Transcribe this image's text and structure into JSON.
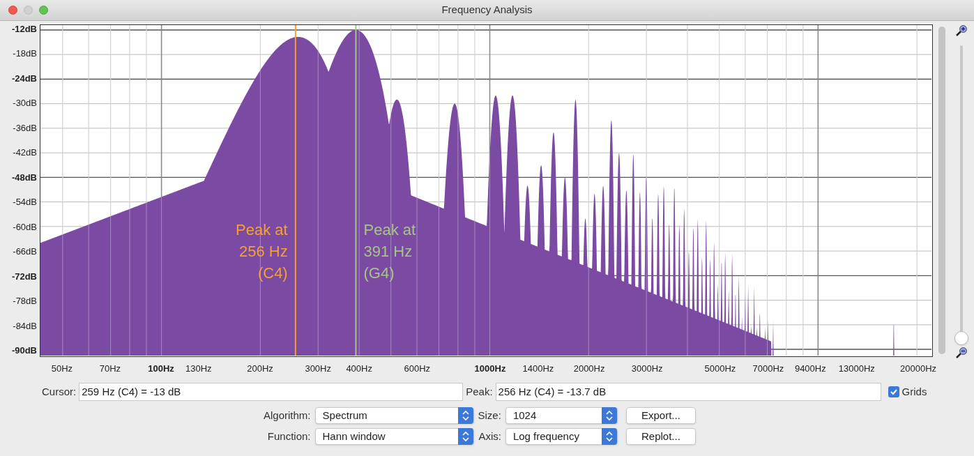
{
  "window": {
    "title": "Frequency Analysis"
  },
  "plot": {
    "y_ticks": [
      {
        "label": "-12dB",
        "major": true
      },
      {
        "label": "-18dB",
        "major": false
      },
      {
        "label": "-24dB",
        "major": true
      },
      {
        "label": "-30dB",
        "major": false
      },
      {
        "label": "-36dB",
        "major": false
      },
      {
        "label": "-42dB",
        "major": false
      },
      {
        "label": "-48dB",
        "major": true
      },
      {
        "label": "-54dB",
        "major": false
      },
      {
        "label": "-60dB",
        "major": false
      },
      {
        "label": "-66dB",
        "major": false
      },
      {
        "label": "-72dB",
        "major": true
      },
      {
        "label": "-78dB",
        "major": false
      },
      {
        "label": "-84dB",
        "major": false
      },
      {
        "label": "-90dB",
        "major": true
      }
    ],
    "x_ticks": [
      {
        "label": "50Hz",
        "major": false
      },
      {
        "label": "70Hz",
        "major": false
      },
      {
        "label": "100Hz",
        "major": true
      },
      {
        "label": "130Hz",
        "major": false
      },
      {
        "label": "200Hz",
        "major": false
      },
      {
        "label": "300Hz",
        "major": false
      },
      {
        "label": "400Hz",
        "major": false
      },
      {
        "label": "600Hz",
        "major": false
      },
      {
        "label": "1000Hz",
        "major": true
      },
      {
        "label": "1400Hz",
        "major": false
      },
      {
        "label": "2000Hz",
        "major": false
      },
      {
        "label": "3000Hz",
        "major": false
      },
      {
        "label": "5000Hz",
        "major": false
      },
      {
        "label": "7000Hz",
        "major": false
      },
      {
        "label": "9400Hz",
        "major": false
      },
      {
        "label": "13000Hz",
        "major": false
      },
      {
        "label": "20000Hz",
        "major": false
      }
    ],
    "markers": [
      {
        "lines": [
          "Peak at",
          "256 Hz",
          "(C4)"
        ],
        "color": "#f5a030"
      },
      {
        "lines": [
          "Peak at",
          "391 Hz",
          "(G4)"
        ],
        "color": "#a8c48a"
      }
    ]
  },
  "zoom_slider": {
    "level": 0
  },
  "cursor": {
    "label": "Cursor:",
    "value": "259 Hz (C4) = -13 dB"
  },
  "peak": {
    "label": "Peak:",
    "value": "256 Hz (C4) = -13.7 dB"
  },
  "grids": {
    "label": "Grids",
    "checked": true
  },
  "selects": [
    {
      "label": "Algorithm:",
      "value": "Spectrum"
    },
    {
      "label": "Size:",
      "value": "1024"
    },
    {
      "label": "Function:",
      "value": "Hann window"
    },
    {
      "label": "Axis:",
      "value": "Log frequency"
    }
  ],
  "buttons": [
    "Export...",
    "Replot..."
  ]
}
